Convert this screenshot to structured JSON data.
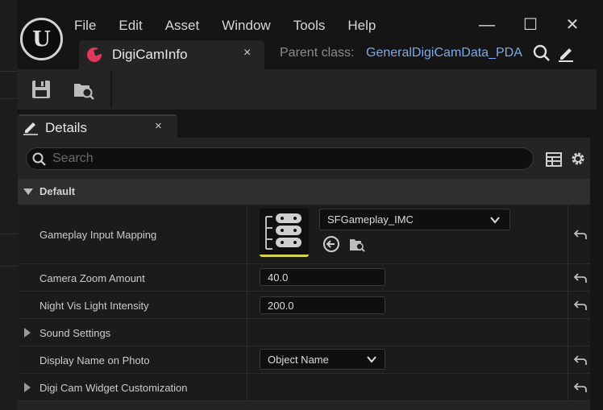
{
  "menu": [
    "File",
    "Edit",
    "Asset",
    "Window",
    "Tools",
    "Help"
  ],
  "window_controls": {
    "minimize": "—",
    "maximize": "☐",
    "close": "✕"
  },
  "asset_tab": {
    "title": "DigiCamInfo",
    "close": "×"
  },
  "parent_class": {
    "label": "Parent class:",
    "value": "GeneralDigiCamData_PDA"
  },
  "details": {
    "tab_title": "Details",
    "tab_close": "×",
    "search_placeholder": "Search",
    "category": "Default",
    "rows": {
      "gameplay_input_mapping": {
        "label": "Gameplay Input Mapping",
        "asset": "SFGameplay_IMC"
      },
      "camera_zoom": {
        "label": "Camera Zoom Amount",
        "value": "40.0"
      },
      "night_vis": {
        "label": "Night Vis Light Intensity",
        "value": "200.0"
      },
      "sound_settings": {
        "label": "Sound Settings"
      },
      "display_name": {
        "label": "Display Name on Photo",
        "value": "Object Name"
      },
      "widget_custom": {
        "label": "Digi Cam Widget Customization"
      }
    }
  },
  "colors": {
    "accent_link": "#7fa8e8",
    "asset_icon": "#e0385a",
    "thumb_underline": "#d6d44a"
  }
}
